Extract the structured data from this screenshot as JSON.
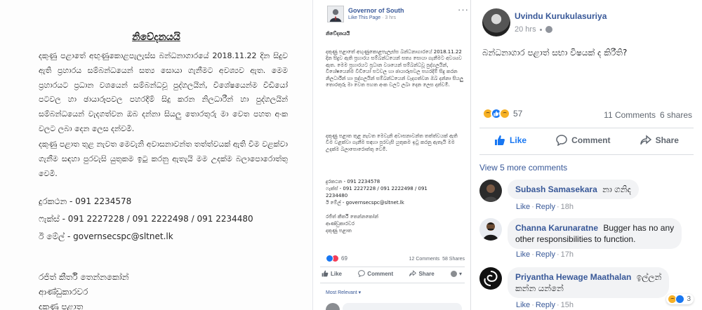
{
  "notice": {
    "title": "නිවේදනයයි",
    "paragraph1": "දකුණු පළාතේ අඟුණුකොළපැලැස්ස බන්ධනාගාරයේ 2018.11.22 දින සිදුව ඇති ප්‍රහාරය සම්බන්ධයෙන් සත්‍ය සොයා ගැනීමට අවශ්‍යව ඇත. මෙම ප්‍රහාරයට ප්‍රධාන වශයෙන් සම්බන්ධවූ පුද්ගලයින්, විශේෂයෙන්ම වීඩියෝ පටවල හා ඡායාරූපවල පහරදීම් සිදු කරන නිලධාරීන් හා පුද්ගලයින් සම්බන්ධයෙන් වැදගත්වන ඔබ දන්නා සියලු තොරතුරු මා වෙත පහත අංක වලට ලබා දෙන ලෙස දන්වමි.",
    "paragraph2": "දකුණු පළාත තුළ නැවත මෙවැනි අවාසනාවන්ත තත්ත්වයක් ඇති වීම වළක්වා ගැනීම සඳහා පුරවැසි යුතුකම ඉටු කරනු ඇතැයි මම උදක්ම බලාපොරොත්තු වෙමි.",
    "phone": "දුරකථන - 091 2234578",
    "fax": "ෆැක්ස් - 091 2227228 / 091 2222498 / 091 2234480",
    "email": "ඊ මේල් - governsecspc@sltnet.lk",
    "sig1": "රජිත් කීර්ති තෙන්නකෝන්",
    "sig2": "ආණ්ඩුකාරවර",
    "sig3": "දකුණු පළාත"
  },
  "post": {
    "page_name": "Governor of South",
    "like_page": "Like This Page",
    "time": "3 hrs",
    "title": "නිවේදනයයි",
    "paragraph1": "දකුණු පළාතේ අඟුණුකොළපැලැස්ස බන්ධනාගාරයේ 2018.11.22 දින සිදුව ඇති ප්‍රහාරය සම්බන්ධයෙන් සත්‍ය සොයා ගැනීමට අවශ්‍යව ඇත. මෙම ප්‍රහාරයට ප්‍රධාන වශයෙන් සම්බන්ධවූ පුද්ගලයින්, විශේෂයෙන්ම වීඩියෝ පටවල හා ඡායාරූපවල පහරදීම් සිදු කරන නිලධාරීන් හා පුද්ගලයින් සම්බන්ධයෙන් වැදගත්වන ඔබ දන්නා සියලු තොරතුරු මා වෙත පහත අංක වලට ලබා දෙන ලෙස දන්වමි.",
    "paragraph2": "දකුණු පළාත තුළ නැවත මෙවැනි අවාසනාවන්ත තත්ත්වයක් ඇති වීම වළක්වා ගැනීම සඳහා පුරවැසි යුතුකම ඉටු කරනු ඇතැයි මම උදක්ම බලාපොරොත්තු වෙමි.",
    "phone": "දුරකථන - 091 2234578",
    "fax1": "ෆැක්ස් - 091 2227228 / 091 2222498 / 091",
    "fax2": "2234480",
    "email": "ඊ මේල් - governsecspc@sltnet.lk",
    "sig1": "රජිත් කීර්ති තෙන්නකෝන්",
    "sig2": "ආණ්ඩුකාරවර",
    "sig3": "දකුණු පළාත",
    "reactions": "69",
    "comments": "12 Comments",
    "shares": "58 Shares",
    "like": "Like",
    "comment": "Comment",
    "share": "Share",
    "sort": "Most Relevant ▾"
  },
  "panel": {
    "op_name": "Uvindu Kurukulasuriya",
    "op_time": "20 hrs",
    "op_text": "බන්ධනාගාර පළාත් සභා විෂයක් ද කිරීති?",
    "reaction_count": "57",
    "comments": "11 Comments",
    "shares": "6 shares",
    "like": "Like",
    "comment": "Comment",
    "share": "Share",
    "view_more": "View 5 more comments",
    "comment_list": [
      {
        "name": "Subash Samasekara",
        "text": "නා ගනිද",
        "like": "Like",
        "reply": "Reply",
        "time": "18h"
      },
      {
        "name": "Channa Karunaratne",
        "text": "Bugger has no any",
        "text2": "other responsibilities to function.",
        "like": "Like",
        "reply": "Reply",
        "time": "17h"
      },
      {
        "name": "Priyantha Hewage Maathalan",
        "text": "ඉල්ලන්",
        "text2": "කන්න යන්නේ",
        "like": "Like",
        "reply": "Reply",
        "time": "15h",
        "react_count": "3"
      }
    ]
  },
  "colors": {
    "fb_link": "#385898",
    "fb_blue": "#1877f2",
    "meta_gray": "#90949c",
    "bubble": "#f2f3f5"
  }
}
